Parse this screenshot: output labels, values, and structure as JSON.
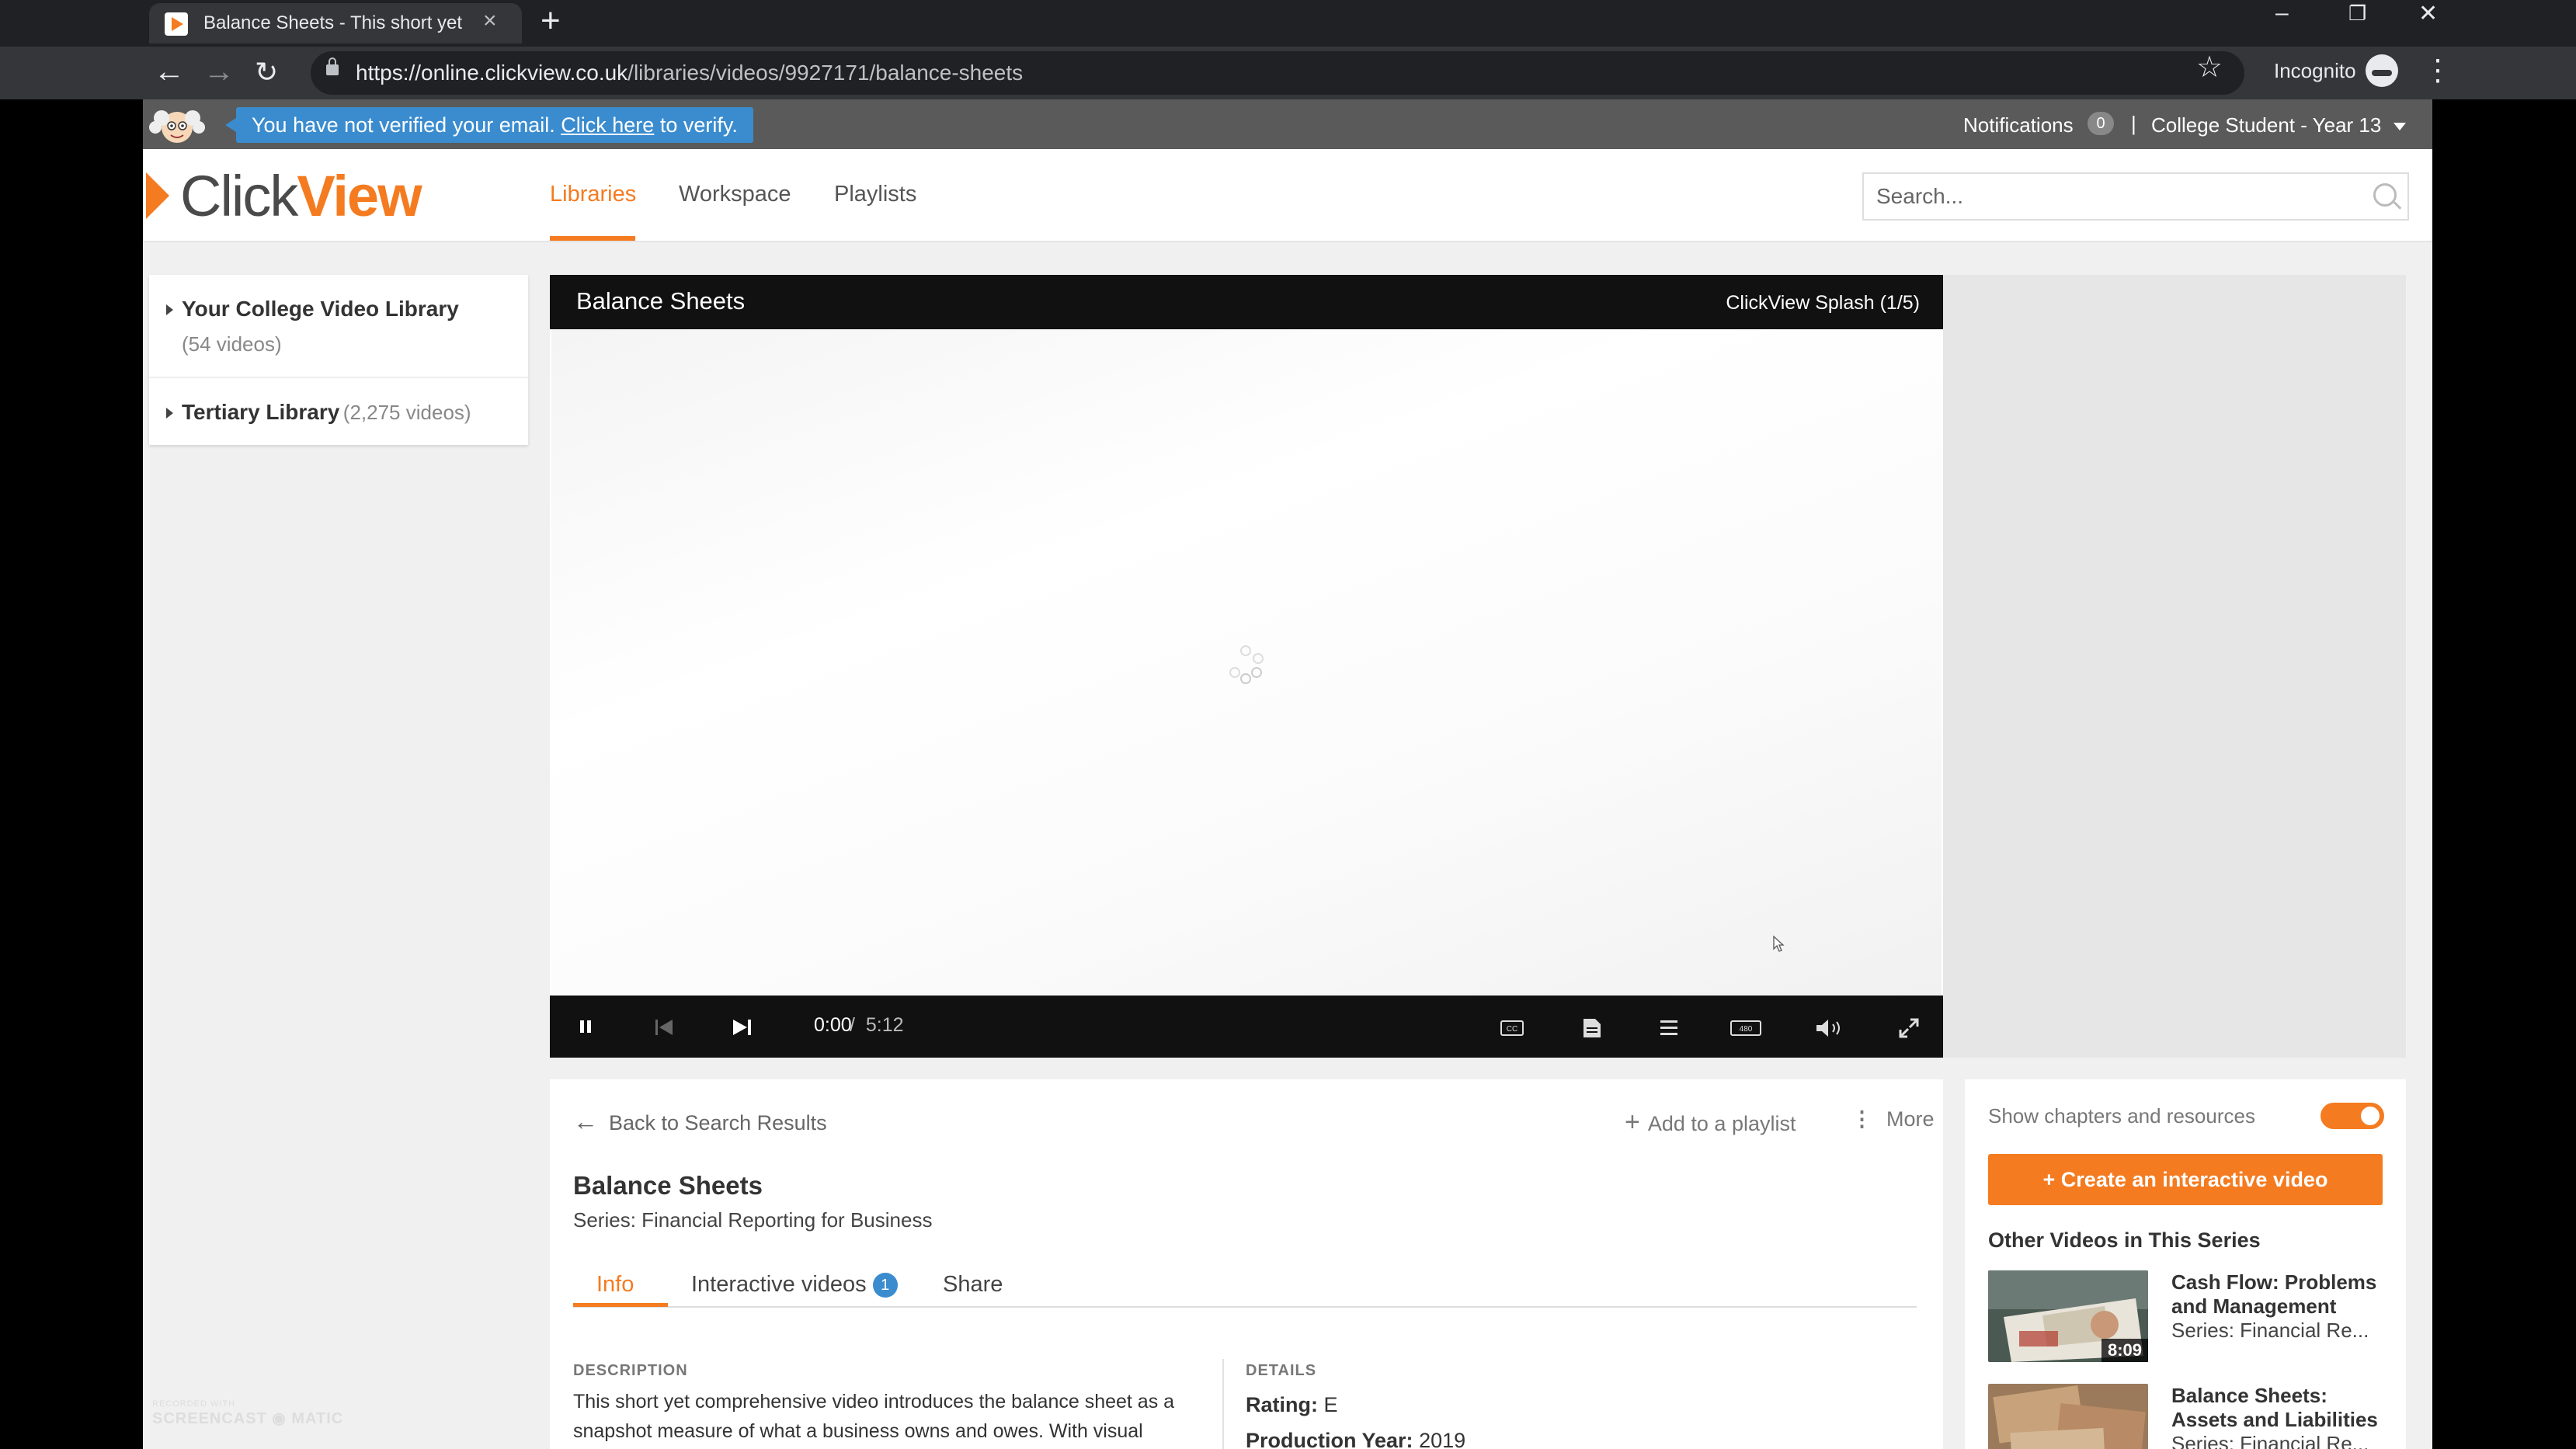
{
  "browser": {
    "tab_title": "Balance Sheets - This short yet comprehensive video introduces the balance sheet",
    "url_host": "https://online.clickview.co.uk",
    "url_path": "/libraries/videos/9927171/balance-sheets",
    "incognito_label": "Incognito"
  },
  "verify_bar": {
    "message_prefix": "You have not verified your email.",
    "link_text": "Click here",
    "message_suffix": "to verify.",
    "notifications_label": "Notifications",
    "notifications_count": "0",
    "separator": "|",
    "user_label": "College Student - Year 13"
  },
  "header": {
    "logo_click": "Click",
    "logo_view": "View",
    "nav": [
      "Libraries",
      "Workspace",
      "Playlists"
    ],
    "search_placeholder": "Search..."
  },
  "sidebar": {
    "libraries": [
      {
        "name": "Your College Video Library",
        "count": "(54 videos)"
      },
      {
        "name": "Tertiary Library",
        "count": "(2,275 videos)"
      }
    ]
  },
  "player": {
    "title": "Balance Sheets",
    "splash_info": "ClickView Splash  (1/5)",
    "time_current": "0:00",
    "time_separator": "/",
    "time_duration": "5:12"
  },
  "info": {
    "back_label": "Back to Search Results",
    "add_playlist_label": "Add to a playlist",
    "more_label": "More",
    "title": "Balance Sheets",
    "series": "Series: Financial Reporting for Business",
    "tabs": [
      "Info",
      "Interactive videos",
      "Share"
    ],
    "interactive_count": "1",
    "description_label": "DESCRIPTION",
    "description": "This short yet comprehensive video introduces the balance sheet as a snapshot measure of what a business owns and owes. With visual examples of everyday business situations, it discusses the key components...",
    "details_label": "DETAILS",
    "rating_label": "Rating:",
    "rating_value": "E",
    "production_year_label": "Production Year:",
    "production_year_value": "2019"
  },
  "side": {
    "chapters_label": "Show chapters and resources",
    "chapters_enabled": true,
    "create_button": "+ Create an interactive video",
    "other_title": "Other Videos in This Series",
    "related": [
      {
        "title": "Cash Flow: Problems and Management",
        "series": "Series: Financial Re...",
        "duration": "8:09"
      },
      {
        "title": "Balance Sheets: Assets and Liabilities",
        "series": "Series: Financial Re...",
        "duration": ""
      }
    ]
  },
  "watermark": {
    "line1": "RECORDED WITH",
    "line2": "SCREENCAST",
    "line3": "MATIC"
  },
  "colors": {
    "accent": "#f47b20",
    "info_blue": "#3a8ccf",
    "chrome_dark": "#202124"
  }
}
